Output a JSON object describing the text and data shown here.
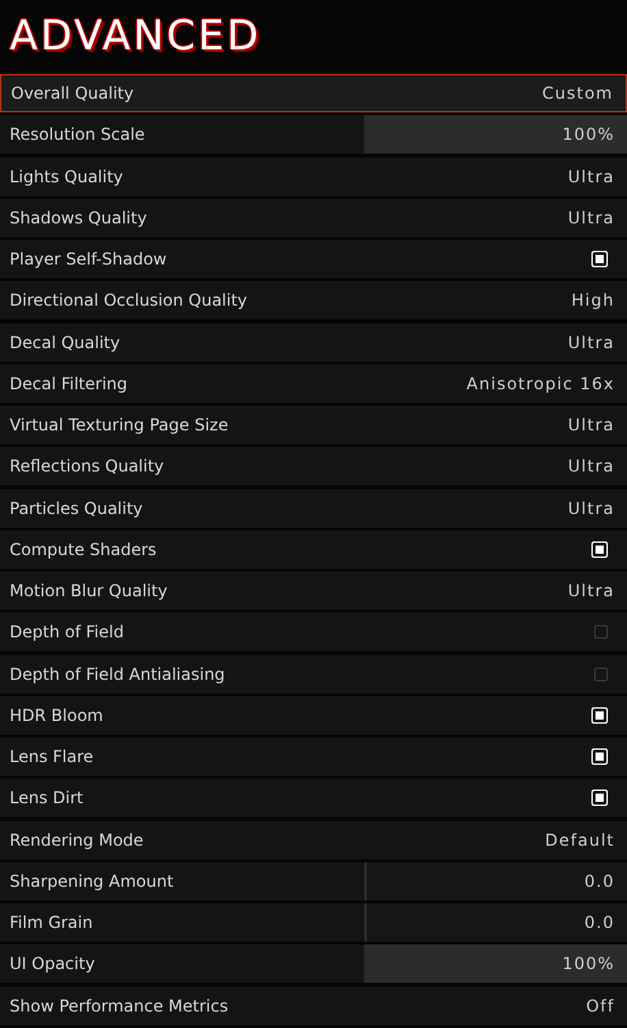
{
  "title": "ADVANCED",
  "settings": [
    {
      "label": "Overall Quality",
      "kind": "option",
      "value": "Custom",
      "selected": true
    },
    {
      "label": "Resolution Scale",
      "kind": "slider",
      "value": "100%",
      "level": 1,
      "selected": false
    },
    {
      "label": "Lights Quality",
      "kind": "option",
      "value": "Ultra",
      "selected": false
    },
    {
      "label": "Shadows Quality",
      "kind": "option",
      "value": "Ultra",
      "selected": false
    },
    {
      "label": "Player Self-Shadow",
      "kind": "checkbox",
      "checked": true,
      "selected": false
    },
    {
      "label": "Directional Occlusion Quality",
      "kind": "option",
      "value": "High",
      "selected": false
    },
    {
      "label": "Decal Quality",
      "kind": "option",
      "value": "Ultra",
      "selected": false
    },
    {
      "label": "Decal Filtering",
      "kind": "option",
      "value": "Anisotropic 16x",
      "selected": false
    },
    {
      "label": "Virtual Texturing Page Size",
      "kind": "option",
      "value": "Ultra",
      "selected": false
    },
    {
      "label": "Reflections Quality",
      "kind": "option",
      "value": "Ultra",
      "selected": false
    },
    {
      "label": "Particles Quality",
      "kind": "option",
      "value": "Ultra",
      "selected": false
    },
    {
      "label": "Compute Shaders",
      "kind": "checkbox",
      "checked": true,
      "selected": false
    },
    {
      "label": "Motion Blur Quality",
      "kind": "option",
      "value": "Ultra",
      "selected": false
    },
    {
      "label": "Depth of Field",
      "kind": "checkbox",
      "checked": false,
      "selected": false
    },
    {
      "label": "Depth of Field Antialiasing",
      "kind": "checkbox",
      "checked": false,
      "selected": false
    },
    {
      "label": "HDR Bloom",
      "kind": "checkbox",
      "checked": true,
      "selected": false
    },
    {
      "label": "Lens Flare",
      "kind": "checkbox",
      "checked": true,
      "selected": false
    },
    {
      "label": "Lens Dirt",
      "kind": "checkbox",
      "checked": true,
      "selected": false
    },
    {
      "label": "Rendering Mode",
      "kind": "option",
      "value": "Default",
      "selected": false
    },
    {
      "label": "Sharpening Amount",
      "kind": "slider",
      "value": "0.0",
      "level": 0,
      "selected": false
    },
    {
      "label": "Film Grain",
      "kind": "slider",
      "value": "0.0",
      "level": 0,
      "selected": false
    },
    {
      "label": "UI Opacity",
      "kind": "slider",
      "value": "100%",
      "level": 1,
      "selected": false
    },
    {
      "label": "Show Performance Metrics",
      "kind": "option",
      "value": "Off",
      "selected": false
    }
  ]
}
